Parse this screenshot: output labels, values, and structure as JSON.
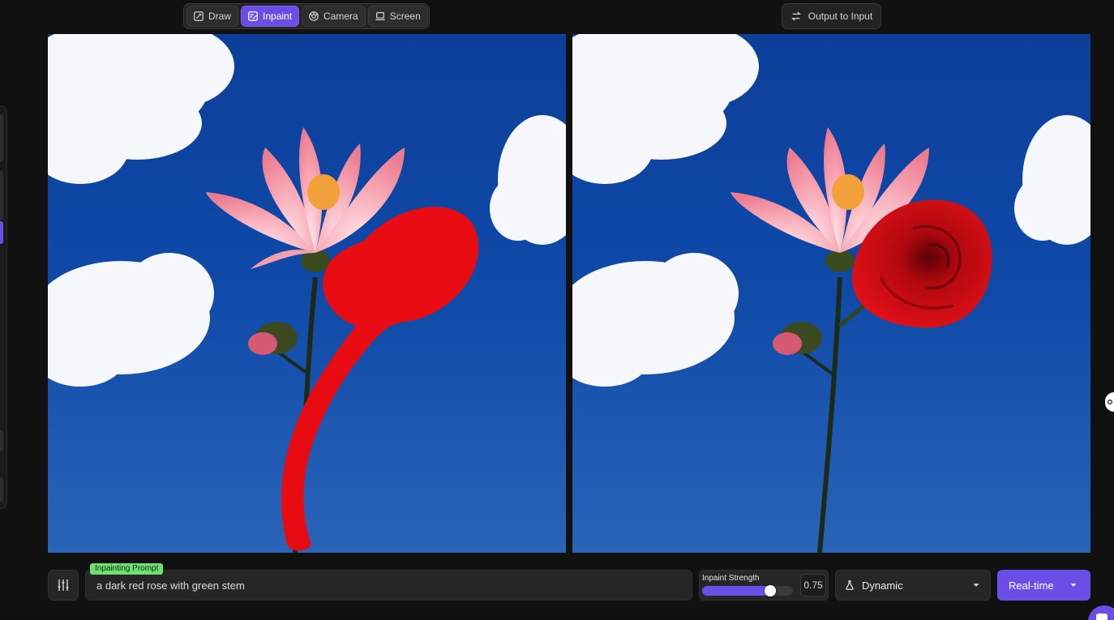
{
  "toolbar": {
    "modes": [
      {
        "label": "Draw",
        "icon": "draw-icon",
        "active": false
      },
      {
        "label": "Inpaint",
        "icon": "inpaint-icon",
        "active": true
      },
      {
        "label": "Camera",
        "icon": "camera-icon",
        "active": false
      },
      {
        "label": "Screen",
        "icon": "screen-icon",
        "active": false
      }
    ],
    "output_to_input_label": "Output to Input",
    "output_to_input_icon": "swap-arrows-icon"
  },
  "canvas": {
    "input_mask_color": "#e80c12",
    "sky_color": "#0f48a8"
  },
  "bottom_bar": {
    "settings_icon": "sliders-icon",
    "prompt_tag": "Inpainting Prompt",
    "prompt_value": "a dark red rose with green stem",
    "strength_label": "Inpaint Strength",
    "strength_value": "0.75",
    "strength_fraction": 0.75,
    "style_select_value": "Dynamic",
    "style_icon": "flask-icon",
    "run_mode_label": "Real-time"
  },
  "colors": {
    "accent": "#6b4ee6",
    "tag_green": "#6fe06f",
    "background": "#111111"
  }
}
